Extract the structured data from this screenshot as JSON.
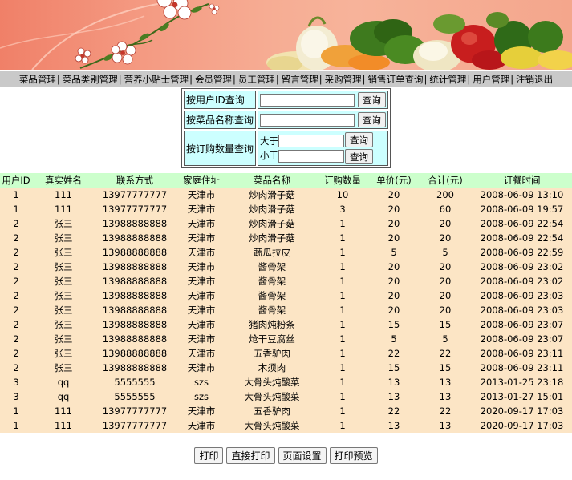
{
  "nav": {
    "items": [
      "菜品管理",
      "菜品类别管理",
      "营养小贴士管理",
      "会员管理",
      "员工管理",
      "留言管理",
      "采购管理",
      "销售订单查询",
      "统计管理",
      "用户管理",
      "注销退出"
    ],
    "separator": "|"
  },
  "query": {
    "by_user_id_label": "按用户ID查询",
    "by_user_id_value": "",
    "by_dish_name_label": "按菜品名称查询",
    "by_dish_name_value": "",
    "by_quantity_label": "按订购数量查询",
    "greater_label": "大于",
    "greater_value": "",
    "less_label": "小于",
    "less_value": "",
    "button_label": "查询"
  },
  "orders": {
    "headers": [
      "用户ID",
      "真实姓名",
      "联系方式",
      "家庭住址",
      "菜品名称",
      "订购数量",
      "单价(元)",
      "合计(元)",
      "订餐时间"
    ],
    "rows": [
      [
        "1",
        "111",
        "13977777777",
        "天津市",
        "炒肉滑子菇",
        "10",
        "20",
        "200",
        "2008-06-09 13:10"
      ],
      [
        "1",
        "111",
        "13977777777",
        "天津市",
        "炒肉滑子菇",
        "3",
        "20",
        "60",
        "2008-06-09 19:57"
      ],
      [
        "2",
        "张三",
        "13988888888",
        "天津市",
        "炒肉滑子菇",
        "1",
        "20",
        "20",
        "2008-06-09 22:54"
      ],
      [
        "2",
        "张三",
        "13988888888",
        "天津市",
        "炒肉滑子菇",
        "1",
        "20",
        "20",
        "2008-06-09 22:54"
      ],
      [
        "2",
        "张三",
        "13988888888",
        "天津市",
        "蔬瓜拉皮",
        "1",
        "5",
        "5",
        "2008-06-09 22:59"
      ],
      [
        "2",
        "张三",
        "13988888888",
        "天津市",
        "酱骨架",
        "1",
        "20",
        "20",
        "2008-06-09 23:02"
      ],
      [
        "2",
        "张三",
        "13988888888",
        "天津市",
        "酱骨架",
        "1",
        "20",
        "20",
        "2008-06-09 23:02"
      ],
      [
        "2",
        "张三",
        "13988888888",
        "天津市",
        "酱骨架",
        "1",
        "20",
        "20",
        "2008-06-09 23:03"
      ],
      [
        "2",
        "张三",
        "13988888888",
        "天津市",
        "酱骨架",
        "1",
        "20",
        "20",
        "2008-06-09 23:03"
      ],
      [
        "2",
        "张三",
        "13988888888",
        "天津市",
        "猪肉炖粉条",
        "1",
        "15",
        "15",
        "2008-06-09 23:07"
      ],
      [
        "2",
        "张三",
        "13988888888",
        "天津市",
        "炝干豆腐丝",
        "1",
        "5",
        "5",
        "2008-06-09 23:07"
      ],
      [
        "2",
        "张三",
        "13988888888",
        "天津市",
        "五香驴肉",
        "1",
        "22",
        "22",
        "2008-06-09 23:11"
      ],
      [
        "2",
        "张三",
        "13988888888",
        "天津市",
        "木须肉",
        "1",
        "15",
        "15",
        "2008-06-09 23:11"
      ],
      [
        "3",
        "qq",
        "5555555",
        "szs",
        "大骨头炖酸菜",
        "1",
        "13",
        "13",
        "2013-01-25 23:18"
      ],
      [
        "3",
        "qq",
        "5555555",
        "szs",
        "大骨头炖酸菜",
        "1",
        "13",
        "13",
        "2013-01-27 15:01"
      ],
      [
        "1",
        "111",
        "13977777777",
        "天津市",
        "五香驴肉",
        "1",
        "22",
        "22",
        "2020-09-17 17:03"
      ],
      [
        "1",
        "111",
        "13977777777",
        "天津市",
        "大骨头炖酸菜",
        "1",
        "13",
        "13",
        "2020-09-17 17:03"
      ]
    ]
  },
  "actions": {
    "print": "打印",
    "direct_print": "直接打印",
    "page_setup": "页面设置",
    "print_preview": "打印预览"
  },
  "colors": {
    "nav_bg": "#c9c9c9",
    "query_cell_bg": "#ccffff",
    "header_bg": "#ccffcc",
    "row_bg": "#fce5c5"
  }
}
